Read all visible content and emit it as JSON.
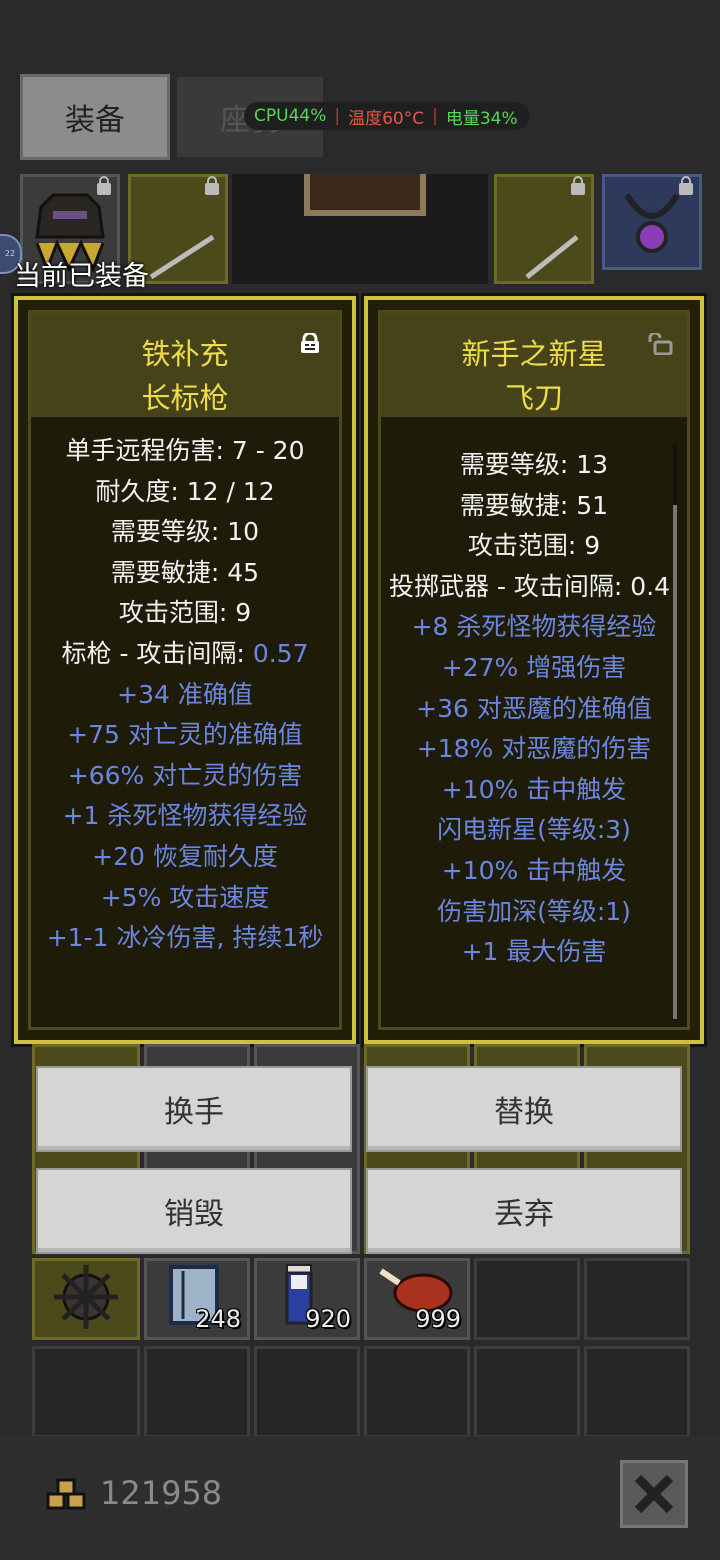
{
  "tabs": {
    "equip": "装备",
    "mount": "座骑"
  },
  "hud": {
    "cpu": "CPU44%",
    "temp": "温度60°C",
    "battery": "电量34%",
    "cpu_color": "#57d557",
    "temp_color": "#e05a4a",
    "battery_color": "#57d557"
  },
  "equipped_label": "当前已装备",
  "badge_number": "22",
  "left_item": {
    "name_line1": "铁补充",
    "name_line2": "长标枪",
    "lock": "locked",
    "stats": [
      "单手远程伤害: 7 - 20",
      "耐久度: 12 / 12",
      "需要等级: 10",
      "需要敏捷: 45",
      "攻击范围: 9"
    ],
    "interval_label": "标枪 - 攻击间隔: ",
    "interval_value": "0.57",
    "affixes": [
      "+34 准确值",
      "+75 对亡灵的准确值",
      "+66% 对亡灵的伤害",
      "+1 杀死怪物获得经验",
      "+20 恢复耐久度",
      "+5% 攻击速度",
      "+1-1 冰冷伤害, 持续1秒"
    ]
  },
  "right_item": {
    "name_line1": "新手之新星",
    "name_line2": "飞刀",
    "lock": "unlocked",
    "stats": [
      "需要等级: 13",
      "需要敏捷: 51",
      "攻击范围: 9",
      "投掷武器 - 攻击间隔: 0.4"
    ],
    "affixes": [
      "+8 杀死怪物获得经验",
      "+27% 增强伤害",
      "+36 对恶魔的准确值",
      "+18% 对恶魔的伤害",
      "+10% 击中触发",
      "闪电新星(等级:3)",
      "+10% 击中触发",
      "伤害加深(等级:1)",
      "+1 最大伤害"
    ]
  },
  "buttons": {
    "swap_hand": "换手",
    "replace": "替换",
    "destroy": "销毁",
    "drop": "丢弃"
  },
  "inventory_counts": {
    "scroll": "248",
    "potion": "920",
    "meat": "999"
  },
  "gold": "121958",
  "colors": {
    "title_yellow": "#ecdc4a",
    "affix_blue": "#6c86e0",
    "stat_white": "#f2f2f2",
    "panel_border": "#cfc23a"
  }
}
